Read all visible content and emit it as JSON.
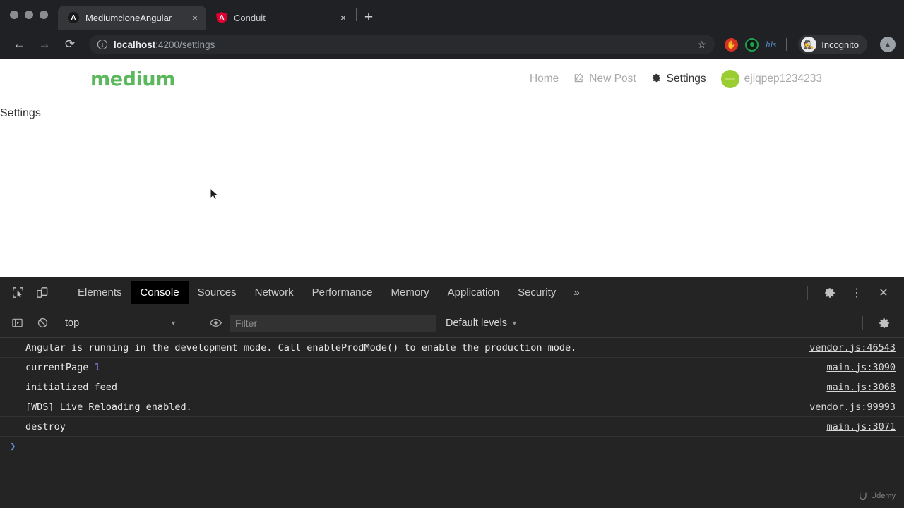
{
  "browser": {
    "tabs": [
      {
        "title": "MediumcloneAngular",
        "favicon": "angular-dark-icon",
        "active": true,
        "close_label": "×"
      },
      {
        "title": "Conduit",
        "favicon": "angular-red-icon",
        "active": false,
        "close_label": "×"
      }
    ],
    "new_tab_label": "+",
    "nav": {
      "back_label": "←",
      "forward_label": "→",
      "reload_label": "⟳"
    },
    "address": {
      "host": "localhost",
      "path": ":4200/settings",
      "security_icon": "info-circle-icon",
      "bookmark_label": "☆"
    },
    "extensions": [
      {
        "name": "hand-extension-icon",
        "glyph": "✋",
        "color": "#d93025"
      },
      {
        "name": "ring-extension-icon",
        "glyph": "",
        "color": "#1e9e52"
      },
      {
        "name": "script-extension-icon",
        "glyph": "hls",
        "color": "#5b8ac7"
      }
    ],
    "incognito": {
      "label": "Incognito",
      "icon": "incognito-icon",
      "glyph": "🕵"
    },
    "profile_label": "▲"
  },
  "site": {
    "brand": "medium",
    "nav": [
      {
        "label": "Home",
        "icon": null,
        "active": false
      },
      {
        "label": "New Post",
        "icon": "edit-square-icon",
        "glyph": "✎",
        "active": false
      },
      {
        "label": "Settings",
        "icon": "gear-icon",
        "glyph": "⚙",
        "active": true
      }
    ],
    "user": {
      "name": "ejiqpep1234233",
      "avatar_color": "#9acd32"
    },
    "page_title": "Settings"
  },
  "devtools": {
    "toolbar_icons": [
      {
        "name": "inspect-element-icon"
      },
      {
        "name": "device-toolbar-icon"
      }
    ],
    "tabs": [
      {
        "label": "Elements",
        "active": false
      },
      {
        "label": "Console",
        "active": true
      },
      {
        "label": "Sources",
        "active": false
      },
      {
        "label": "Network",
        "active": false
      },
      {
        "label": "Performance",
        "active": false
      },
      {
        "label": "Memory",
        "active": false
      },
      {
        "label": "Application",
        "active": false
      },
      {
        "label": "Security",
        "active": false
      }
    ],
    "more_tabs_label": "»",
    "right_icons": [
      {
        "name": "settings-gear-icon",
        "glyph": "⚙"
      },
      {
        "name": "kebab-menu-icon",
        "glyph": "⋮"
      },
      {
        "name": "close-devtools-icon",
        "glyph": "✕"
      }
    ],
    "filter_bar": {
      "sidebar_toggle_icon": "console-sidebar-icon",
      "clear_console_icon": "clear-console-icon",
      "clear_glyph": "⊘",
      "context": "top",
      "context_caret": "▼",
      "eye_icon": "live-expression-icon",
      "filter_placeholder": "Filter",
      "levels": "Default levels",
      "levels_caret": "▼",
      "settings_icon": "console-settings-icon",
      "settings_glyph": "⚙"
    },
    "logs": [
      {
        "message": "Angular is running in the development mode. Call enableProdMode() to enable the production mode.",
        "number": null,
        "source": "vendor.js:46543"
      },
      {
        "message": "currentPage ",
        "number": "1",
        "source": "main.js:3090"
      },
      {
        "message": "initialized feed",
        "number": null,
        "source": "main.js:3068"
      },
      {
        "message": "[WDS] Live Reloading enabled.",
        "number": null,
        "source": "vendor.js:99993"
      },
      {
        "message": "destroy",
        "number": null,
        "source": "main.js:3071"
      }
    ],
    "prompt": "❯"
  },
  "watermark": {
    "label": "Udemy",
    "mark": "∪"
  }
}
